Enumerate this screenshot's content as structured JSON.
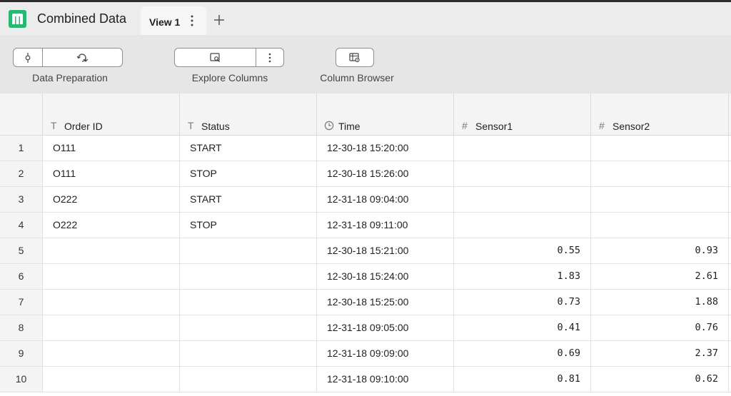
{
  "app": {
    "title": "Combined Data",
    "logo_icon": "app-logo-icon",
    "accent": "#2bb673"
  },
  "tabs": [
    {
      "label": "View 1",
      "menu_icon": "kebab-vertical-icon"
    }
  ],
  "add_tab_icon": "plus-icon",
  "toolbar": {
    "data_preparation": {
      "label": "Data Preparation",
      "icons": [
        "commit-node-icon",
        "refresh-transform-icon"
      ]
    },
    "explore_columns": {
      "label": "Explore Columns",
      "icons": [
        "column-search-icon",
        "kebab-vertical-icon"
      ]
    },
    "column_browser": {
      "label": "Column Browser",
      "icons": [
        "table-settings-icon"
      ]
    }
  },
  "table": {
    "columns": [
      {
        "name": "Order ID",
        "type_icon": "T",
        "kind": "text"
      },
      {
        "name": "Status",
        "type_icon": "T",
        "kind": "text"
      },
      {
        "name": "Time",
        "type_icon": "clock-icon",
        "kind": "datetime"
      },
      {
        "name": "Sensor1",
        "type_icon": "#",
        "kind": "number"
      },
      {
        "name": "Sensor2",
        "type_icon": "#",
        "kind": "number"
      }
    ],
    "rows": [
      {
        "n": "1",
        "cells": [
          "O111",
          "START",
          "12-30-18 15:20:00",
          "",
          ""
        ]
      },
      {
        "n": "2",
        "cells": [
          "O111",
          "STOP",
          "12-30-18 15:26:00",
          "",
          ""
        ]
      },
      {
        "n": "3",
        "cells": [
          "O222",
          "START",
          "12-31-18 09:04:00",
          "",
          ""
        ]
      },
      {
        "n": "4",
        "cells": [
          "O222",
          "STOP",
          "12-31-18 09:11:00",
          "",
          ""
        ]
      },
      {
        "n": "5",
        "cells": [
          "",
          "",
          "12-30-18 15:21:00",
          "0.55",
          "0.93"
        ]
      },
      {
        "n": "6",
        "cells": [
          "",
          "",
          "12-30-18 15:24:00",
          "1.83",
          "2.61"
        ]
      },
      {
        "n": "7",
        "cells": [
          "",
          "",
          "12-30-18 15:25:00",
          "0.73",
          "1.88"
        ]
      },
      {
        "n": "8",
        "cells": [
          "",
          "",
          "12-31-18 09:05:00",
          "0.41",
          "0.76"
        ]
      },
      {
        "n": "9",
        "cells": [
          "",
          "",
          "12-31-18 09:09:00",
          "0.69",
          "2.37"
        ]
      },
      {
        "n": "10",
        "cells": [
          "",
          "",
          "12-31-18 09:10:00",
          "0.81",
          "0.62"
        ]
      }
    ]
  }
}
